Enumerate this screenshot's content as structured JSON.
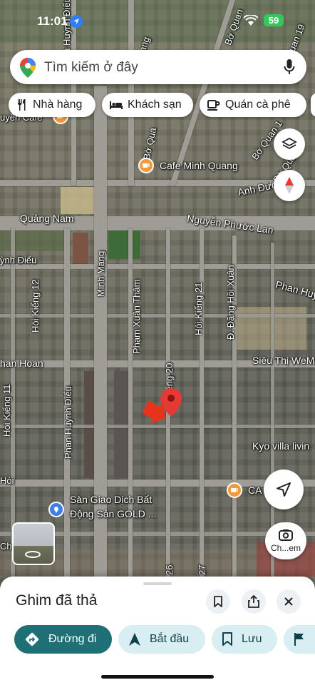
{
  "status": {
    "time": "11:01",
    "battery": "59"
  },
  "search": {
    "placeholder": "Tìm kiếm ở đây"
  },
  "chips": [
    {
      "label": "Nhà hàng",
      "icon": "fork-knife-icon"
    },
    {
      "label": "Khách sạn",
      "icon": "bed-icon"
    },
    {
      "label": "Quán cà phê",
      "icon": "coffee-cup-icon"
    }
  ],
  "map": {
    "street_labels": {
      "top_left_vertical": "Phan Huỳnh Điểu",
      "top_partial": "Mạng",
      "top_right_1": "Bờ Quan",
      "top_right_2": "Quan 19",
      "cafe_partial": "uyền Cafe",
      "bo_quan_a": "Bờ Qua",
      "bo_quan_b": "Bờ Quan 1",
      "bo_quan_c": "Bờ Quan",
      "cafe_minh_quang": "Cafe Minh Quang",
      "anh_duc": "Anh Đức",
      "quang_nam": "Quảng Nam",
      "nguyen_phuoc_lan": "Nguyễn Phước Lan",
      "ynh_dieu": "ỳnh Điểu",
      "minh_mang": "Minh Mạng",
      "hoi_kieng_12": "Hói Kiểng 12",
      "pham_xuan_tham": "Phạm Xuân Thâm",
      "hoi_kieng_21": "Hói Kiểng 21",
      "dang_hoi_xuan": "Đ. Đặng Hồi Xuân",
      "phan_huy": "Phan Huy",
      "han_hoan": "han Hoan",
      "sieu_thi": "Siêu Thị WeM",
      "kieng_20": "Kiểng 20",
      "hoi_kieng_11": "Hói Kiểng 11",
      "phan_huynh_dieu": "Phan Huỳnh Điểu",
      "kyo_villa": "Kyo villa livin",
      "hoi": "Hói",
      "ca_uy": "CA",
      "san_giao_dich_1": "Sàn Giao Dịch Bất",
      "san_giao_dich_2": "Động Sản GOLD ...",
      "ch": "Ch",
      "n26": "26",
      "n27": "27"
    }
  },
  "controls": {
    "layers_icon": "layers-icon",
    "compass_icon": "compass-icon",
    "locate_icon": "navigation-arrow-icon",
    "lens_label": "Ch...em"
  },
  "sheet": {
    "title": "Ghim đã thả",
    "actions": [
      {
        "label": "Đường đi",
        "icon": "directions-icon"
      },
      {
        "label": "Bắt đầu",
        "icon": "navigation-icon"
      },
      {
        "label": "Lưu",
        "icon": "bookmark-icon"
      }
    ]
  },
  "colors": {
    "primary_button": "#1f6f77",
    "secondary_button": "#d8eef2",
    "pin": "#e53935",
    "poi_orange": "#f29a3a"
  }
}
